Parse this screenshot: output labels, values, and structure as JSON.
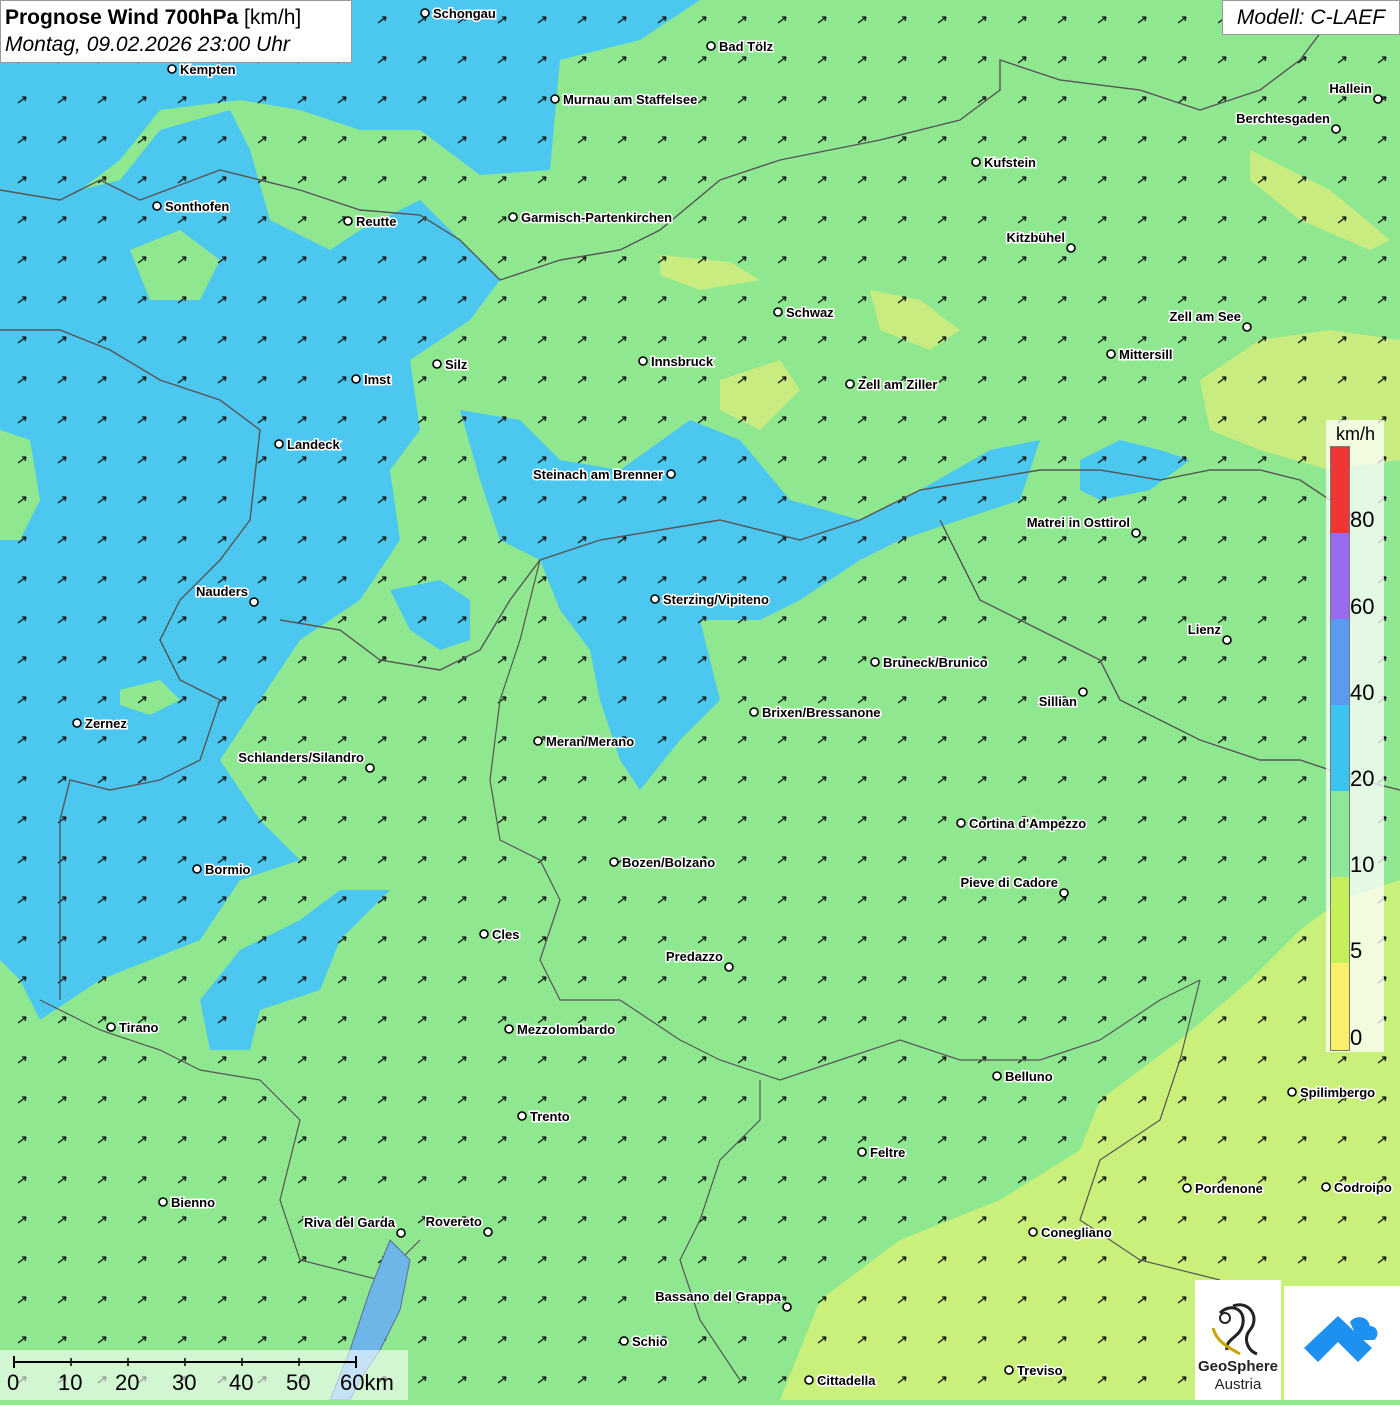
{
  "header": {
    "title_main": "Prognose Wind 700hPa",
    "title_unit": " [km/h]",
    "datetime": "Montag, 09.02.2026 23:00 Uhr",
    "model": "Modell: C-LAEF"
  },
  "legend": {
    "unit": "km/h",
    "ticks": [
      "80",
      "60",
      "40",
      "20",
      "10",
      "5",
      "0"
    ],
    "colors": [
      "#f03535",
      "#9a6af0",
      "#5a9af0",
      "#3ac4f2",
      "#8ee89a",
      "#c6f05a",
      "#f8f06a"
    ]
  },
  "scale_bar": {
    "labels": [
      "0",
      "10",
      "20",
      "30",
      "40",
      "50",
      "60km"
    ]
  },
  "logos": {
    "geosphere_line1": "GeoSphere",
    "geosphere_line2": "Austria"
  },
  "cities": [
    {
      "name": "Schongau"
    },
    {
      "name": "Kempten"
    },
    {
      "name": "Bad Tölz"
    },
    {
      "name": "Murnau am Staffelsee"
    },
    {
      "name": "Hallein"
    },
    {
      "name": "Berchtesgaden"
    },
    {
      "name": "Kufstein"
    },
    {
      "name": "Sonthofen"
    },
    {
      "name": "Reutte"
    },
    {
      "name": "Garmisch-Partenkirchen"
    },
    {
      "name": "Kitzbühel"
    },
    {
      "name": "Schwaz"
    },
    {
      "name": "Zell am See"
    },
    {
      "name": "Mittersill"
    },
    {
      "name": "Imst"
    },
    {
      "name": "Silz"
    },
    {
      "name": "Innsbruck"
    },
    {
      "name": "Zell am Ziller"
    },
    {
      "name": "Landeck"
    },
    {
      "name": "Steinach am Brenner"
    },
    {
      "name": "Matrei in Osttirol"
    },
    {
      "name": "Nauders"
    },
    {
      "name": "Sterzing/Vipiteno"
    },
    {
      "name": "Lienz"
    },
    {
      "name": "Bruneck/Brunico"
    },
    {
      "name": "Sillian"
    },
    {
      "name": "Zernez"
    },
    {
      "name": "Brixen/Bressanone"
    },
    {
      "name": "Meran/Merano"
    },
    {
      "name": "Schlanders/Silandro"
    },
    {
      "name": "Cortina d'Ampezzo"
    },
    {
      "name": "Bozen/Bolzano"
    },
    {
      "name": "Bormio"
    },
    {
      "name": "Pieve di Cadore"
    },
    {
      "name": "Cles"
    },
    {
      "name": "Predazzo"
    },
    {
      "name": "Tirano"
    },
    {
      "name": "Mezzolombardo"
    },
    {
      "name": "Belluno"
    },
    {
      "name": "Spilimbergo"
    },
    {
      "name": "Trento"
    },
    {
      "name": "Feltre"
    },
    {
      "name": "Pordenone"
    },
    {
      "name": "Codroipo"
    },
    {
      "name": "Bienno"
    },
    {
      "name": "Riva del Garda"
    },
    {
      "name": "Rovereto"
    },
    {
      "name": "Conegliano"
    },
    {
      "name": "Bassano del Grappa"
    },
    {
      "name": "Schio"
    },
    {
      "name": "Treviso"
    },
    {
      "name": "Cittadella"
    }
  ]
}
